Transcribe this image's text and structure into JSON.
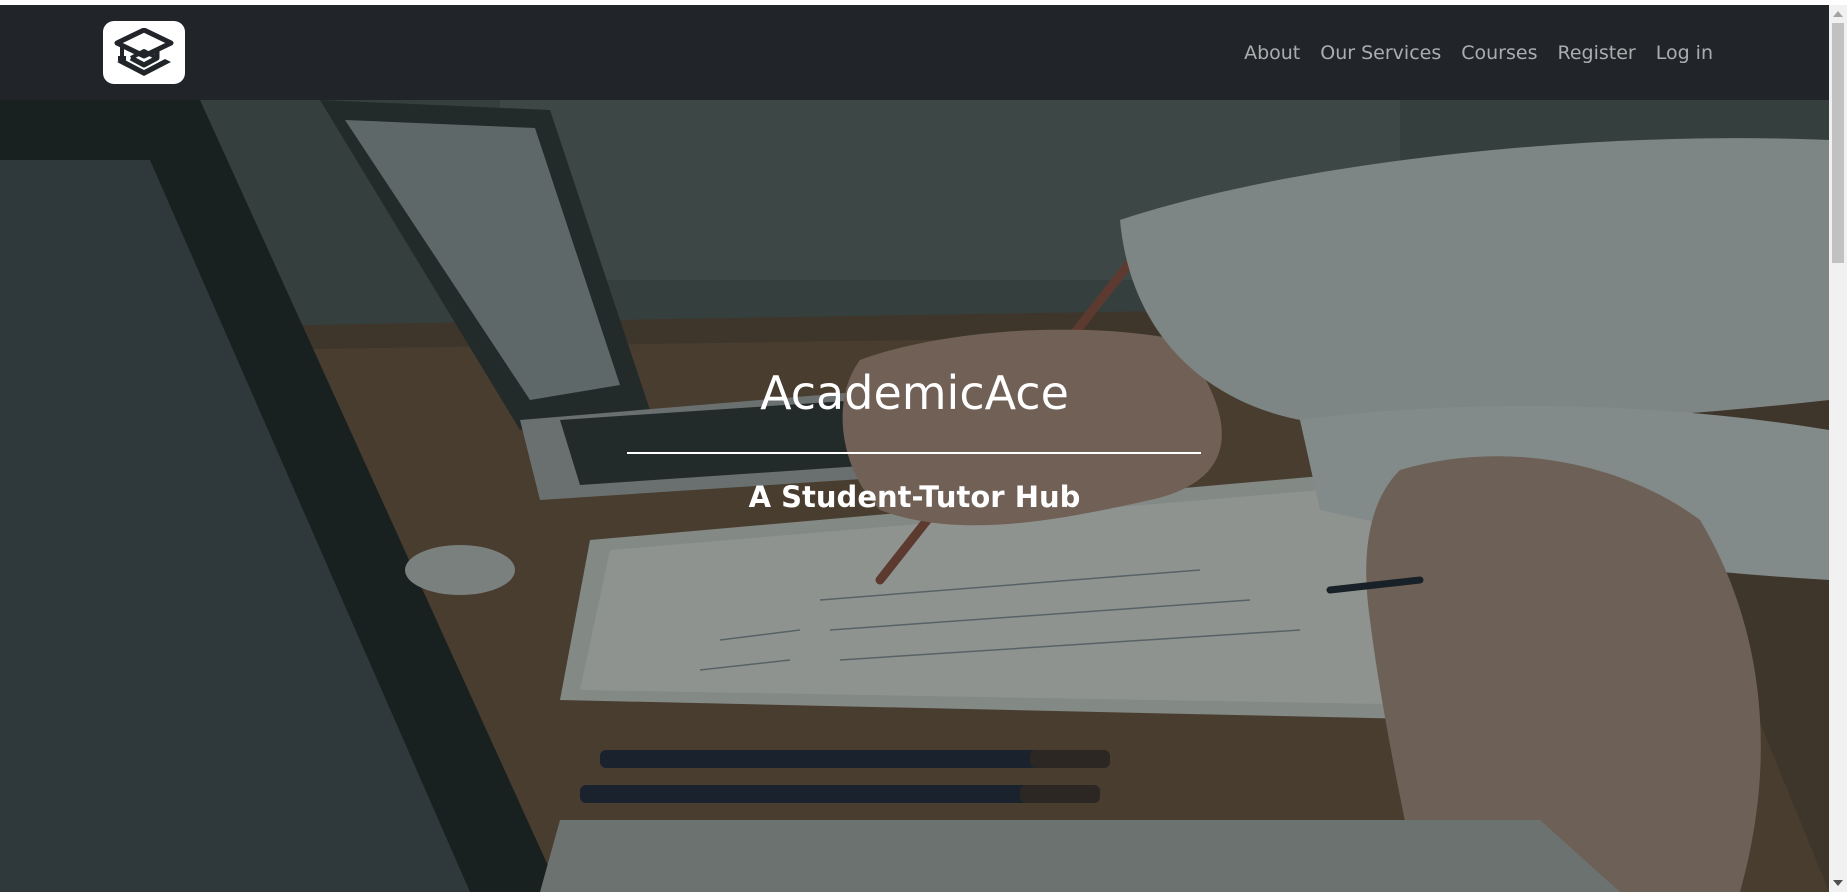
{
  "navbar": {
    "logo_icon": "graduation-cap-logo-icon",
    "links": [
      {
        "label": "About"
      },
      {
        "label": "Our Services"
      },
      {
        "label": "Courses"
      },
      {
        "label": "Register"
      },
      {
        "label": "Log in"
      }
    ]
  },
  "hero": {
    "title": "AcademicAce",
    "subtitle": "A Student-Tutor Hub",
    "background_icon": "desk-study-photo"
  },
  "colors": {
    "navbar_bg": "#212529",
    "nav_link": "rgba(255,255,255,0.62)",
    "hero_text": "#ffffff"
  }
}
